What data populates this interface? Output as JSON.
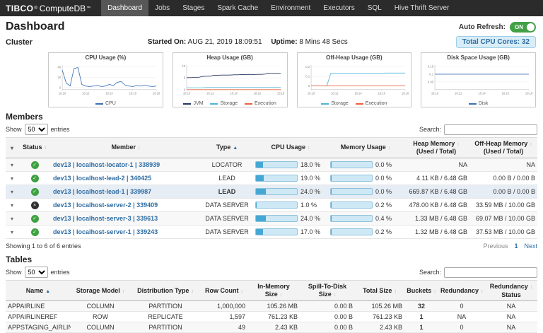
{
  "icons": {
    "caret_down": "▾",
    "check": "✓",
    "cross": "×",
    "sort": "↕",
    "sort_asc": "▲"
  },
  "colors": {
    "accent_blue": "#2e6da4",
    "bar_track": "#cfe8f5",
    "bar_fill": "#45a7d4",
    "status_running": "#3fa142",
    "status_stopped": "#2f2f2f",
    "badge_bg": "#d9edf7",
    "toggle_on": "#43a047",
    "buckets_alert": "#d9534f"
  },
  "navbar": {
    "brand_primary": "TIBCO",
    "brand_reg": "®",
    "brand_secondary": "ComputeDB",
    "brand_tm": "™",
    "items": [
      {
        "label": "Dashboard",
        "active": true
      },
      {
        "label": "Jobs"
      },
      {
        "label": "Stages"
      },
      {
        "label": "Spark Cache"
      },
      {
        "label": "Environment"
      },
      {
        "label": "Executors"
      },
      {
        "label": "SQL"
      },
      {
        "label": "Hive Thrift Server"
      }
    ]
  },
  "header": {
    "page_title": "Dashboard",
    "auto_refresh_label": "Auto Refresh:",
    "auto_refresh_state": "ON"
  },
  "cluster": {
    "section_label": "Cluster",
    "started_on_label": "Started On:",
    "started_on_value": "AUG 21, 2019 18:09:51",
    "uptime_label": "Uptime:",
    "uptime_value": "8 Mins 48 Secs",
    "total_cores_label": "Total CPU Cores:",
    "total_cores_value": "32"
  },
  "chart_data": [
    {
      "type": "line",
      "title": "CPU Usage (%)",
      "x_ticks": [
        "18:10",
        "18:12",
        "18:14",
        "18:16",
        "18:18"
      ],
      "y_ticks": [
        0,
        20,
        40
      ],
      "ylim": [
        -4,
        44
      ],
      "legend_position": "bottom",
      "series": [
        {
          "name": "CPU",
          "color": "#3b6fb6",
          "values": [
            34,
            9,
            3,
            37,
            39,
            6,
            3,
            2,
            3,
            4,
            2,
            3,
            6,
            4,
            10,
            12,
            5,
            3,
            2,
            4,
            3,
            5,
            3,
            2,
            3
          ]
        }
      ]
    },
    {
      "type": "line",
      "title": "Heap Usage (GB)",
      "x_ticks": [
        "18:10",
        "18:12",
        "18:14",
        "18:16",
        "18:18"
      ],
      "y_ticks": [
        0,
        5,
        10
      ],
      "ylim": [
        0,
        10.5
      ],
      "legend_position": "bottom",
      "series": [
        {
          "name": "JVM",
          "color": "#26355f",
          "values": [
            5.1,
            5.1,
            5.2,
            5.2,
            5.6,
            5.7,
            5.7,
            6.1,
            6.1,
            6.2,
            6.2,
            6.2,
            6.3,
            6.3,
            6.4,
            6.4,
            6.5,
            6.4,
            6.5,
            6.5,
            6.6,
            7.0,
            6.9,
            6.9,
            6.9
          ]
        },
        {
          "name": "Storage",
          "color": "#4fb3dc",
          "values": [
            0.8,
            0.8,
            0.8,
            0.8,
            0.8,
            0.9,
            0.9,
            0.9,
            0.9,
            0.9,
            0.9,
            0.9,
            0.9,
            0.9,
            0.9,
            0.9,
            0.9,
            0.9,
            0.9,
            0.9,
            0.9,
            0.9,
            0.9,
            0.9,
            0.9
          ]
        },
        {
          "name": "Execution",
          "color": "#e8613d",
          "values": [
            0,
            0,
            0,
            0,
            0,
            0,
            0,
            0,
            0,
            0,
            0,
            0,
            0,
            0,
            0,
            0,
            0,
            0,
            0,
            0,
            0,
            0,
            0,
            0,
            0
          ]
        }
      ]
    },
    {
      "type": "line",
      "title": "Off-Heap Usage (GB)",
      "x_ticks": [
        "18:10",
        "18:12",
        "18:14",
        "18:16",
        "18:18"
      ],
      "y_ticks": [
        0,
        0.1,
        0.2
      ],
      "ylim": [
        -0.04,
        0.22
      ],
      "legend_position": "bottom",
      "series": [
        {
          "name": "Storage",
          "color": "#4fb3dc",
          "values": [
            0,
            0,
            0,
            0,
            0,
            0.13,
            0.13,
            0.13,
            0.13,
            0.13,
            0.13,
            0.13,
            0.13,
            0.13,
            0.13,
            0.13,
            0.13,
            0.13,
            0.13,
            0.135,
            0.135,
            0.135,
            0.135,
            0.135,
            0.135
          ]
        },
        {
          "name": "Execution",
          "color": "#e8613d",
          "values": [
            0,
            0,
            0,
            0,
            0,
            0,
            0,
            0,
            0,
            0,
            0,
            0,
            0,
            0,
            0,
            0,
            0,
            0,
            0,
            0,
            0,
            0,
            0,
            0,
            0
          ]
        }
      ]
    },
    {
      "type": "line",
      "title": "Disk Space Usage (GB)",
      "x_ticks": [
        "18:10",
        "18:12",
        "18:14",
        "18:16",
        "18:18"
      ],
      "y_ticks": [
        0.05,
        0.1,
        0.15
      ],
      "ylim": [
        0,
        0.16
      ],
      "legend_position": "bottom",
      "series": [
        {
          "name": "Disk",
          "color": "#3b6fb6",
          "values": [
            0.1,
            0.1,
            0.1,
            0.1,
            0.1,
            0.1,
            0.1,
            0.1,
            0.1,
            0.1,
            0.1,
            0.1,
            0.1,
            0.1,
            0.1,
            0.1,
            0.1,
            0.1,
            0.1,
            0.1,
            0.1,
            0.1,
            0.1,
            0.1,
            0.1
          ]
        }
      ]
    }
  ],
  "members": {
    "heading": "Members",
    "show_label": "Show",
    "page_size": "50",
    "entries_label": "entries",
    "search_label": "Search:",
    "columns": [
      {
        "label": "",
        "expander": true
      },
      {
        "label": "Status"
      },
      {
        "label": "Member"
      },
      {
        "label": "Type",
        "sorted": true
      },
      {
        "label": "CPU Usage"
      },
      {
        "label": "Memory Usage"
      },
      {
        "label": "Heap Memory",
        "sub": "(Used / Total)"
      },
      {
        "label": "Off-Heap Memory",
        "sub": "(Used / Total)"
      }
    ],
    "rows": [
      {
        "status": "running",
        "member": "dev13 | localhost-locator-1 | 338939",
        "type": "LOCATOR",
        "cpu_pct": 18,
        "cpu_label": "18.0 %",
        "mem_pct": 0.0,
        "mem_label": "0.0 %",
        "heap": "NA",
        "offheap": "NA"
      },
      {
        "status": "running",
        "member": "dev13 | localhost-lead-2 | 340425",
        "type": "LEAD",
        "cpu_pct": 19,
        "cpu_label": "19.0 %",
        "mem_pct": 0.0,
        "mem_label": "0.0 %",
        "heap": "4.11 KB / 6.48 GB",
        "offheap": "0.00 B / 0.00 B"
      },
      {
        "status": "running",
        "member": "dev13 | localhost-lead-1 | 339987",
        "type": "LEAD",
        "highlight": true,
        "cpu_pct": 24,
        "cpu_label": "24.0 %",
        "mem_pct": 0.0,
        "mem_label": "0.0 %",
        "heap": "669.87 KB / 6.48 GB",
        "offheap": "0.00 B / 0.00 B"
      },
      {
        "status": "stopped",
        "member": "dev13 | localhost-server-2 | 339409",
        "type": "DATA SERVER",
        "cpu_pct": 1,
        "cpu_label": "1.0 %",
        "mem_pct": 0.2,
        "mem_label": "0.2 %",
        "heap": "478.00 KB / 6.48 GB",
        "offheap": "33.59 MB / 10.00 GB"
      },
      {
        "status": "running",
        "member": "dev13 | localhost-server-3 | 339613",
        "type": "DATA SERVER",
        "cpu_pct": 24,
        "cpu_label": "24.0 %",
        "mem_pct": 0.4,
        "mem_label": "0.4 %",
        "heap": "1.33 MB / 6.48 GB",
        "offheap": "69.07 MB / 10.00 GB"
      },
      {
        "status": "running",
        "member": "dev13 | localhost-server-1 | 339243",
        "type": "DATA SERVER",
        "cpu_pct": 17,
        "cpu_label": "17.0 %",
        "mem_pct": 0.2,
        "mem_label": "0.2 %",
        "heap": "1.32 MB / 6.48 GB",
        "offheap": "37.53 MB / 10.00 GB"
      }
    ],
    "summary": "Showing 1 to 6 of 6 entries",
    "pagination": {
      "previous": "Previous",
      "current": "1",
      "next": "Next"
    }
  },
  "tables": {
    "heading": "Tables",
    "show_label": "Show",
    "page_size": "50",
    "entries_label": "entries",
    "search_label": "Search:",
    "columns": [
      {
        "label": "Name",
        "sorted": true
      },
      {
        "label": "Storage Model"
      },
      {
        "label": "Distribution Type"
      },
      {
        "label": "Row Count"
      },
      {
        "label": "In-Memory Size"
      },
      {
        "label": "Spill-To-Disk Size"
      },
      {
        "label": "Total Size"
      },
      {
        "label": "Buckets"
      },
      {
        "label": "Redundancy"
      },
      {
        "label": "Redundancy",
        "sub": "Status"
      }
    ],
    "rows": [
      {
        "name": "APPAIRLINE",
        "storage_model": "COLUMN",
        "distribution_type": "PARTITION",
        "row_count": "1,000,000",
        "in_memory_size": "105.26 MB",
        "spill_size": "0.00 B",
        "total_size": "105.26 MB",
        "buckets": "32",
        "redundancy": "0",
        "redundancy_status": "NA"
      },
      {
        "name": "APPAIRLINEREF",
        "storage_model": "ROW",
        "distribution_type": "REPLICATE",
        "row_count": "1,597",
        "in_memory_size": "761.23 KB",
        "spill_size": "0.00 B",
        "total_size": "761.23 KB",
        "buckets": "1",
        "redundancy": "NA",
        "redundancy_status": "NA"
      },
      {
        "name": "APPSTAGING_AIRLINE",
        "storage_model": "COLUMN",
        "distribution_type": "PARTITION",
        "row_count": "49",
        "in_memory_size": "2.43 KB",
        "spill_size": "0.00 B",
        "total_size": "2.43 KB",
        "buckets": "1",
        "redundancy": "0",
        "redundancy_status": "NA"
      }
    ]
  }
}
